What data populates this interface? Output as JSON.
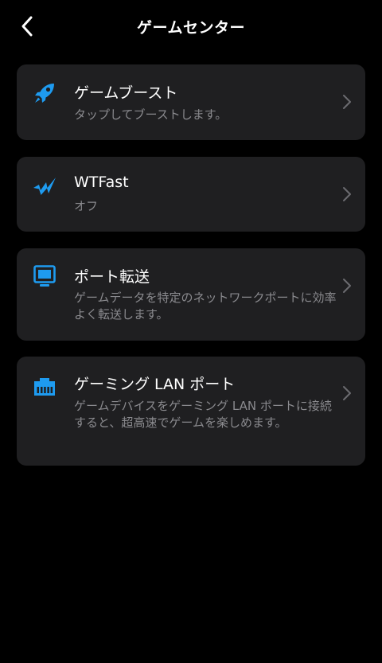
{
  "header": {
    "title": "ゲームセンター",
    "back_icon": "chevron-left-icon"
  },
  "colors": {
    "background": "#000000",
    "card": "#1f1f21",
    "accent": "#1e9bf0",
    "secondary_text": "#8a8a8e",
    "chevron": "#6b6b70"
  },
  "items": [
    {
      "icon": "rocket-icon",
      "title": "ゲームブースト",
      "description": "タップしてブーストします。"
    },
    {
      "icon": "wtfast-icon",
      "title": "WTFast",
      "description": "オフ"
    },
    {
      "icon": "monitor-icon",
      "title": "ポート転送",
      "description": "ゲームデータを特定のネットワークポートに効率よく転送します。"
    },
    {
      "icon": "lan-port-icon",
      "title": "ゲーミング LAN ポート",
      "description": "ゲームデバイスをゲーミング LAN ポートに接続すると、超高速でゲームを楽しめます。"
    }
  ]
}
